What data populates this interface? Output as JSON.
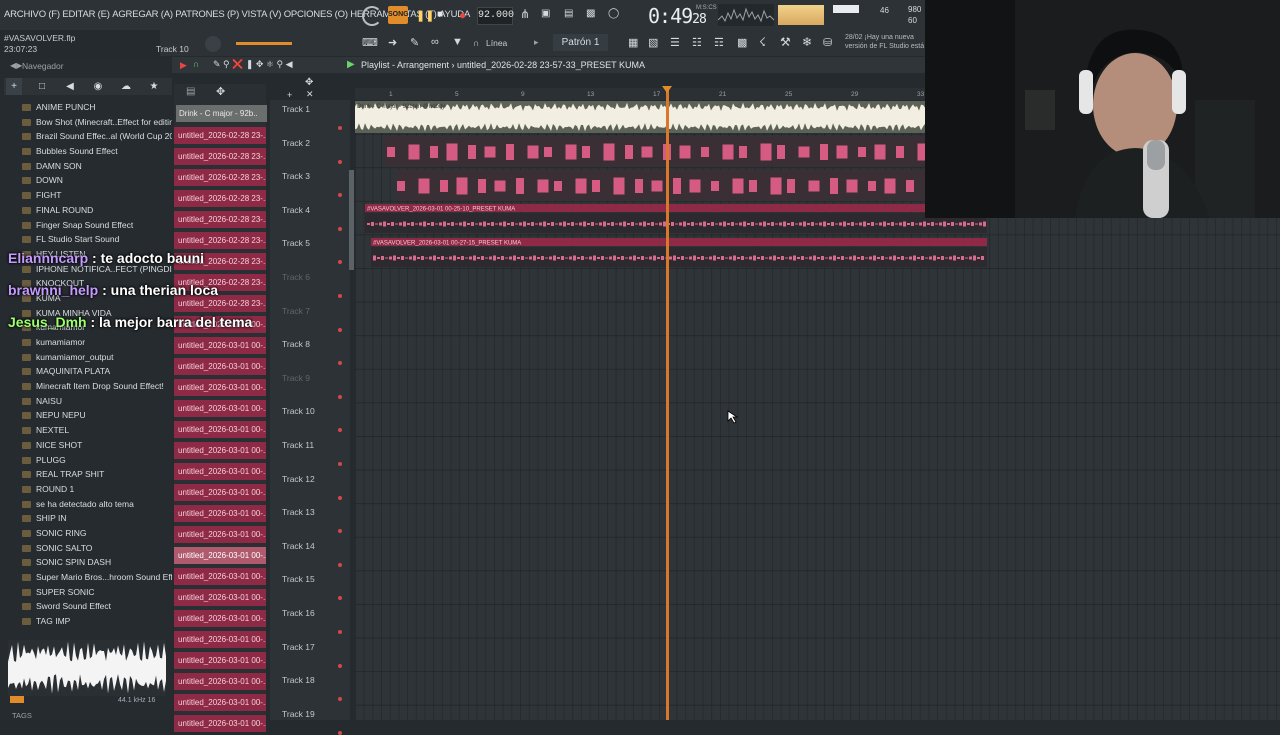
{
  "menu": {
    "items": [
      "ARCHIVO (F)",
      "EDITAR (E)",
      "AGREGAR (A)",
      "PATRONES (P)",
      "VISTA (V)",
      "OPCIONES (O)",
      "HERRAMIENTAS (T)",
      "AYUDA"
    ]
  },
  "transport": {
    "song_label": "SONG",
    "bpm": "92.000",
    "time": "0:49",
    "time_sub": "28",
    "time_unit": "M:S:CS",
    "pattern": "Patrón 1",
    "snap": "Línea"
  },
  "project": {
    "file": "#VASAVOLVER.flp",
    "time": "23:07:23",
    "track_hint": "Track 10"
  },
  "news": {
    "date": "28/02",
    "text": "¡Hay una nueva versión de FL Studio está"
  },
  "browser": {
    "title": "Navegador",
    "items": [
      "ANIME PUNCH",
      "Bow Shot (Minecraft..Effect for editing",
      "Brazil Sound Effec..al (World Cup 2002)",
      "Bubbles Sound Effect",
      "DAMN SON",
      "DOWN",
      "FIGHT",
      "FINAL ROUND",
      "Finger Snap Sound Effect",
      "FL Studio Start Sound",
      "HEY LISTEN",
      "IPHONE NOTIFICA..FECT (PINGDING)",
      "KNOCKOUT",
      "KUMA",
      "KUMA MINHA VIDA",
      "kumamiamor",
      "kumamiamor",
      "kumamiamor_output",
      "MAQUINITA PLATA",
      "Minecraft Item Drop Sound Effect!",
      "NAISU",
      "NEPU NEPU",
      "NEXTEL",
      "NICE SHOT",
      "PLUGG",
      "REAL TRAP SHIT",
      "ROUND 1",
      "se ha detectado alto tema",
      "SHIP IN",
      "SONIC RING",
      "SONIC SALTO",
      "SONIC SPIN DASH",
      "Super Mario Bros...hroom Sound Effect",
      "SUPER SONIC",
      "Sword Sound Effect",
      "TAG IMP"
    ],
    "sample_rate": "44.1 kHz 16",
    "tags_label": "TAGS"
  },
  "clips": {
    "header": "Drink - C major - 92b..",
    "items": [
      "untitled_2026-02-28 23-...",
      "untitled_2026-02-28 23-...",
      "untitled_2026-02-28 23-...",
      "untitled_2026-02-28 23-...",
      "untitled_2026-02-28 23-...",
      "untitled_2026-02-28 23-...",
      "untitled_2026-02-28 23-...",
      "untitled_2026-02-28 23-...",
      "untitled_2026-02-28 23-...",
      "untitled_2026-03-01 00-...",
      "untitled_2026-03-01 00-...",
      "untitled_2026-03-01 00-...",
      "untitled_2026-03-01 00-...",
      "untitled_2026-03-01 00-...",
      "untitled_2026-03-01 00-...",
      "untitled_2026-03-01 00-...",
      "untitled_2026-03-01 00-...",
      "untitled_2026-03-01 00-...",
      "untitled_2026-03-01 00-...",
      "untitled_2026-03-01 00-...",
      "untitled_2026-03-01 00-...",
      "untitled_2026-03-01 00-...",
      "untitled_2026-03-01 00-...",
      "untitled_2026-03-01 00-...",
      "untitled_2026-03-01 00-...",
      "untitled_2026-03-01 00-...",
      "untitled_2026-03-01 00-...",
      "untitled_2026-03-01 00-...",
      "untitled_2026-03-01 00-..."
    ]
  },
  "playlist": {
    "title": "Playlist - Arrangement",
    "subtitle": "untitled_2026-02-28 23-57-33_PRESET KUMA",
    "ruler": [
      "1",
      "5",
      "9",
      "13",
      "17",
      "21",
      "25",
      "29",
      "33"
    ],
    "tracks": [
      "Track 1",
      "Track 2",
      "Track 3",
      "Track 4",
      "Track 5",
      "Track 6",
      "Track 7",
      "Track 8",
      "Track 9",
      "Track 10",
      "Track 11",
      "Track 12",
      "Track 13",
      "Track 14",
      "Track 15",
      "Track 16",
      "Track 17",
      "Track 18",
      "Track 19"
    ],
    "lane1_clip": "Drink - C major - 92bpm @nobdy",
    "lane4_clip": "#VASAVOLVER_2026-03-01 00-25-10_PRESET KUMA",
    "lane5_clip": "#VASAVOLVER_2026-03-01 00-27-15_PRESET KUMA"
  },
  "chat": [
    {
      "user": "Eliannncarp",
      "message": ": te adocto bauni",
      "color": "#c49bff"
    },
    {
      "user": "brawnni_help",
      "message": ": una therian loca",
      "color": "#c49bff"
    },
    {
      "user": "Jesus_Dmh",
      "message": ": la mejor barra del tema",
      "color": "#9dff6b"
    }
  ],
  "colors": {
    "accent": "#e08c2a",
    "clip": "#8e2a45",
    "playhead": "#d9772b",
    "audio": "#f2efe2"
  }
}
